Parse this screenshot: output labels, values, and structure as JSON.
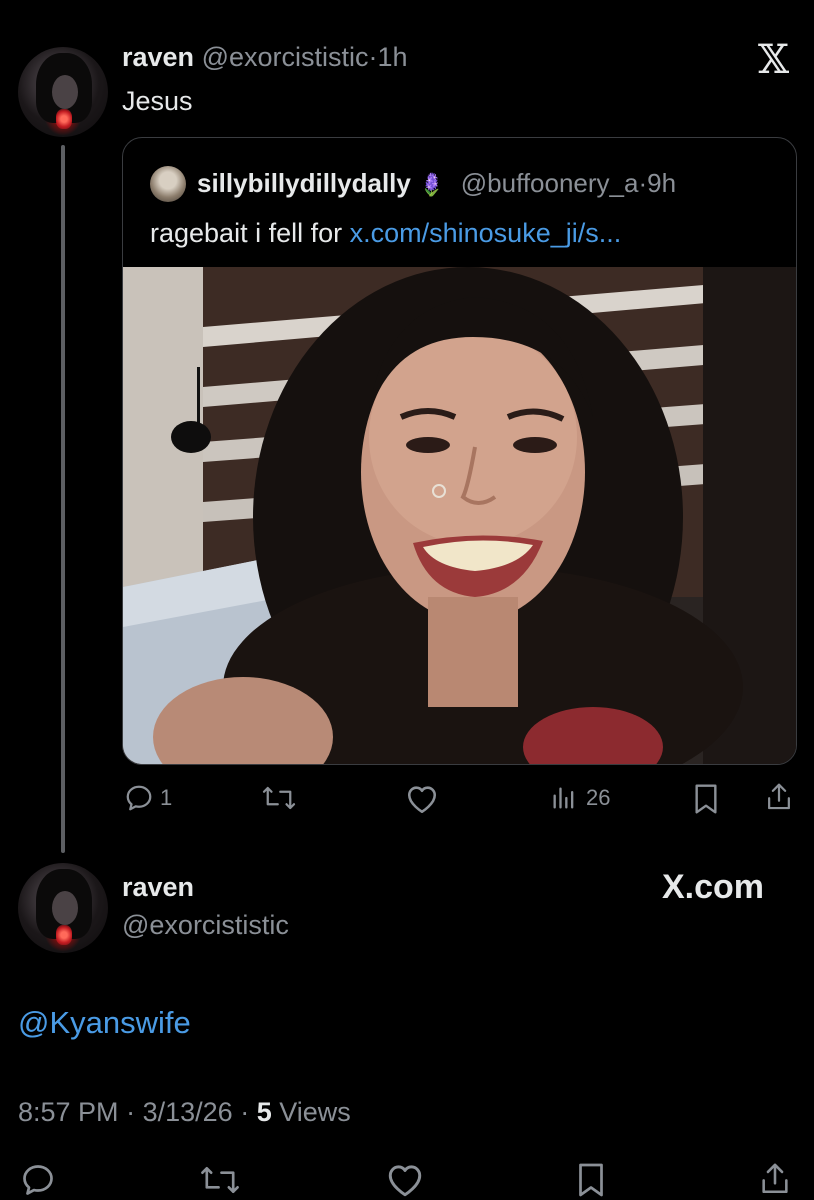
{
  "tweet": {
    "author_name": "raven",
    "handle": "@exorcististic",
    "time_sep": "·",
    "time": "1h",
    "text": "Jesus",
    "brand_icon": "x-logo-icon",
    "quote": {
      "author_name": "sillybillydillydally",
      "emoji": "🪻",
      "handle": "@buffoonery_a",
      "time_sep": "·",
      "time": "9h",
      "text": "ragebait i fell for",
      "link": "x.com/shinosuke_ji/s..."
    },
    "actions": {
      "replies": "1",
      "views": "26"
    }
  },
  "card": {
    "author_name": "raven",
    "handle": "@exorcististic",
    "brand": "X.com",
    "mention": "@Kyanswife",
    "time": "8:57 PM",
    "sep1": "·",
    "date": "3/13/26",
    "sep2": "·",
    "views_count": "5",
    "views_label": "Views"
  },
  "colors": {
    "background": "#000000",
    "text": "#e7e9ea",
    "muted": "#8b9097",
    "link": "#4a9be5",
    "thread_line": "#5d5f63"
  }
}
